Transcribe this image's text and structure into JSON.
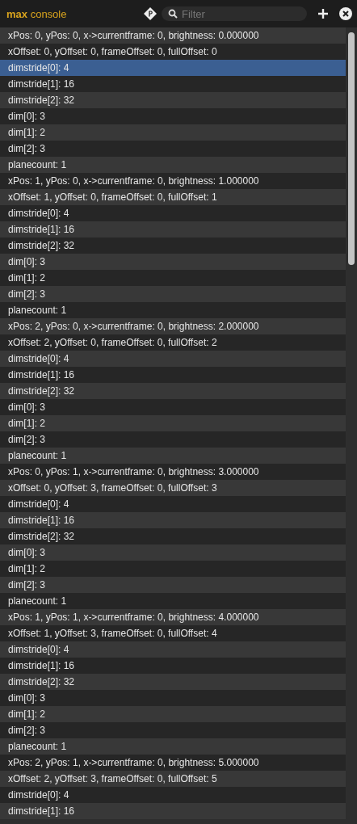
{
  "header": {
    "title_bold": "max",
    "title": "console",
    "filter": {
      "placeholder": "Filter"
    }
  },
  "rows": [
    {
      "text": "xPos: 0, yPos: 0, x->currentframe: 0, brightness: 0.000000",
      "selected": false
    },
    {
      "text": "xOffset: 0, yOffset: 0, frameOffset: 0, fullOffset: 0",
      "selected": false
    },
    {
      "text": "dimstride[0]: 4",
      "selected": true
    },
    {
      "text": "dimstride[1]: 16",
      "selected": false
    },
    {
      "text": "dimstride[2]: 32",
      "selected": false
    },
    {
      "text": "dim[0]: 3",
      "selected": false
    },
    {
      "text": "dim[1]: 2",
      "selected": false
    },
    {
      "text": "dim[2]: 3",
      "selected": false
    },
    {
      "text": "planecount: 1",
      "selected": false
    },
    {
      "text": "xPos: 1, yPos: 0, x->currentframe: 0, brightness: 1.000000",
      "selected": false
    },
    {
      "text": "xOffset: 1, yOffset: 0, frameOffset: 0, fullOffset: 1",
      "selected": false
    },
    {
      "text": "dimstride[0]: 4",
      "selected": false
    },
    {
      "text": "dimstride[1]: 16",
      "selected": false
    },
    {
      "text": "dimstride[2]: 32",
      "selected": false
    },
    {
      "text": "dim[0]: 3",
      "selected": false
    },
    {
      "text": "dim[1]: 2",
      "selected": false
    },
    {
      "text": "dim[2]: 3",
      "selected": false
    },
    {
      "text": "planecount: 1",
      "selected": false
    },
    {
      "text": "xPos: 2, yPos: 0, x->currentframe: 0, brightness: 2.000000",
      "selected": false
    },
    {
      "text": "xOffset: 2, yOffset: 0, frameOffset: 0, fullOffset: 2",
      "selected": false
    },
    {
      "text": "dimstride[0]: 4",
      "selected": false
    },
    {
      "text": "dimstride[1]: 16",
      "selected": false
    },
    {
      "text": "dimstride[2]: 32",
      "selected": false
    },
    {
      "text": "dim[0]: 3",
      "selected": false
    },
    {
      "text": "dim[1]: 2",
      "selected": false
    },
    {
      "text": "dim[2]: 3",
      "selected": false
    },
    {
      "text": "planecount: 1",
      "selected": false
    },
    {
      "text": "xPos: 0, yPos: 1, x->currentframe: 0, brightness: 3.000000",
      "selected": false
    },
    {
      "text": "xOffset: 0, yOffset: 3, frameOffset: 0, fullOffset: 3",
      "selected": false
    },
    {
      "text": "dimstride[0]: 4",
      "selected": false
    },
    {
      "text": "dimstride[1]: 16",
      "selected": false
    },
    {
      "text": "dimstride[2]: 32",
      "selected": false
    },
    {
      "text": "dim[0]: 3",
      "selected": false
    },
    {
      "text": "dim[1]: 2",
      "selected": false
    },
    {
      "text": "dim[2]: 3",
      "selected": false
    },
    {
      "text": "planecount: 1",
      "selected": false
    },
    {
      "text": "xPos: 1, yPos: 1, x->currentframe: 0, brightness: 4.000000",
      "selected": false
    },
    {
      "text": "xOffset: 1, yOffset: 3, frameOffset: 0, fullOffset: 4",
      "selected": false
    },
    {
      "text": "dimstride[0]: 4",
      "selected": false
    },
    {
      "text": "dimstride[1]: 16",
      "selected": false
    },
    {
      "text": "dimstride[2]: 32",
      "selected": false
    },
    {
      "text": "dim[0]: 3",
      "selected": false
    },
    {
      "text": "dim[1]: 2",
      "selected": false
    },
    {
      "text": "dim[2]: 3",
      "selected": false
    },
    {
      "text": "planecount: 1",
      "selected": false
    },
    {
      "text": "xPos: 2, yPos: 1, x->currentframe: 0, brightness: 5.000000",
      "selected": false
    },
    {
      "text": "xOffset: 2, yOffset: 3, frameOffset: 0, fullOffset: 5",
      "selected": false
    },
    {
      "text": "dimstride[0]: 4",
      "selected": false
    },
    {
      "text": "dimstride[1]: 16",
      "selected": false
    }
  ]
}
